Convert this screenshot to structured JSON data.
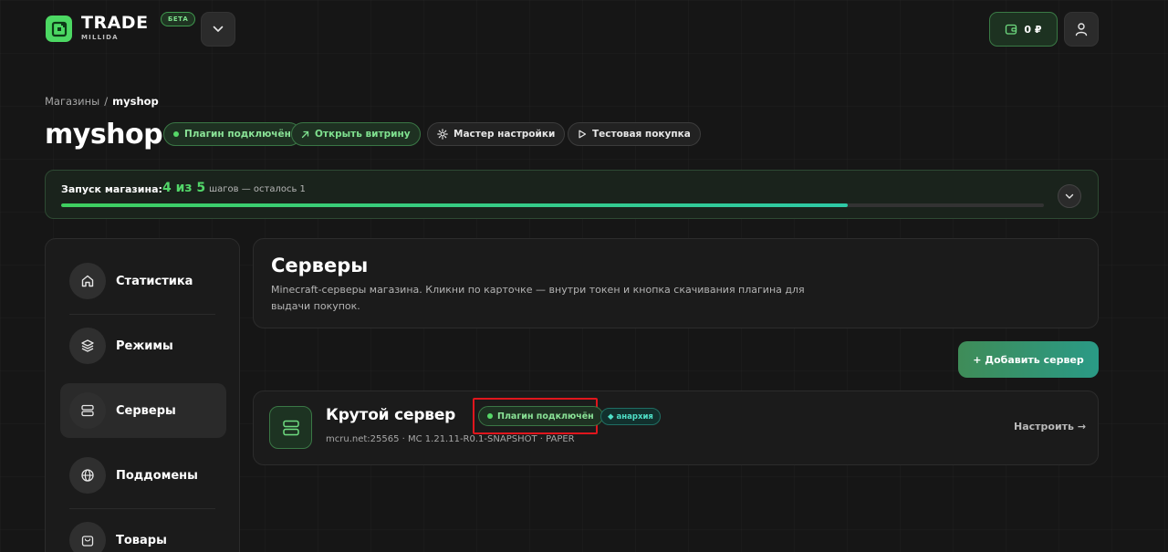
{
  "header": {
    "brand_name": "TRADE",
    "brand_sub": "MILLIDA",
    "beta_badge": "БЕТА",
    "wallet_amount": "0 ₽"
  },
  "breadcrumb": {
    "parent": "Магазины",
    "separator": "/",
    "current": "myshop"
  },
  "page": {
    "title": "myshop",
    "plugin_status": "Плагин подключён",
    "open_storefront": "Открыть витрину",
    "setup_wizard": "Мастер настройки",
    "test_purchase": "Тестовая покупка"
  },
  "launch": {
    "label": "Запуск магазина:",
    "steps": "4 из 5",
    "remaining": "шагов — осталось 1",
    "progress": 0.8
  },
  "sidebar": {
    "items": [
      {
        "label": "Статистика",
        "icon": "home-icon"
      },
      {
        "label": "Режимы",
        "icon": "layers-icon"
      },
      {
        "label": "Серверы",
        "icon": "server-icon"
      },
      {
        "label": "Поддомены",
        "icon": "globe-icon"
      },
      {
        "label": "Товары",
        "icon": "bag-icon"
      }
    ],
    "active_index": 2
  },
  "main": {
    "title": "Серверы",
    "description": "Minecraft-серверы магазина. Кликни по карточке — внутри токен и кнопка скачивания плагина для выдачи покупок.",
    "add_button": "+ Добавить сервер"
  },
  "servers": [
    {
      "name": "Крутой сервер",
      "status": "Плагин подключён",
      "tag": "анархия",
      "meta": "mcru.net:25565 · MC 1.21.11-R0.1-SNAPSHOT · PAPER",
      "configure": "Настроить →"
    }
  ],
  "colors": {
    "background": "#161616",
    "accent_green": "#4cd863",
    "accent_teal": "#2ec9a6",
    "highlight_red": "#e0161d"
  }
}
